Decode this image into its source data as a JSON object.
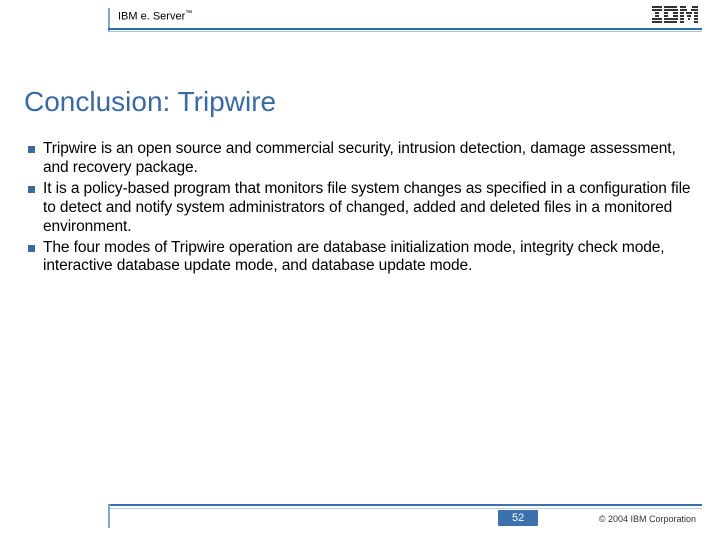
{
  "header": {
    "brand_prefix": "IBM e. Server",
    "brand_tm": "™",
    "logo_label": "IBM"
  },
  "title": "Conclusion: Tripwire",
  "bullets": [
    "Tripwire is an open source and commercial security, intrusion detection, damage assessment, and recovery package.",
    "It is a policy-based program that monitors file system changes as specified in a configuration file to detect and notify system administrators of changed, added and deleted files in a monitored environment.",
    "The four modes of Tripwire operation are database initialization mode, integrity check mode, interactive database update mode, and database update mode."
  ],
  "footer": {
    "page": "52",
    "copyright": "© 2004 IBM Corporation"
  }
}
